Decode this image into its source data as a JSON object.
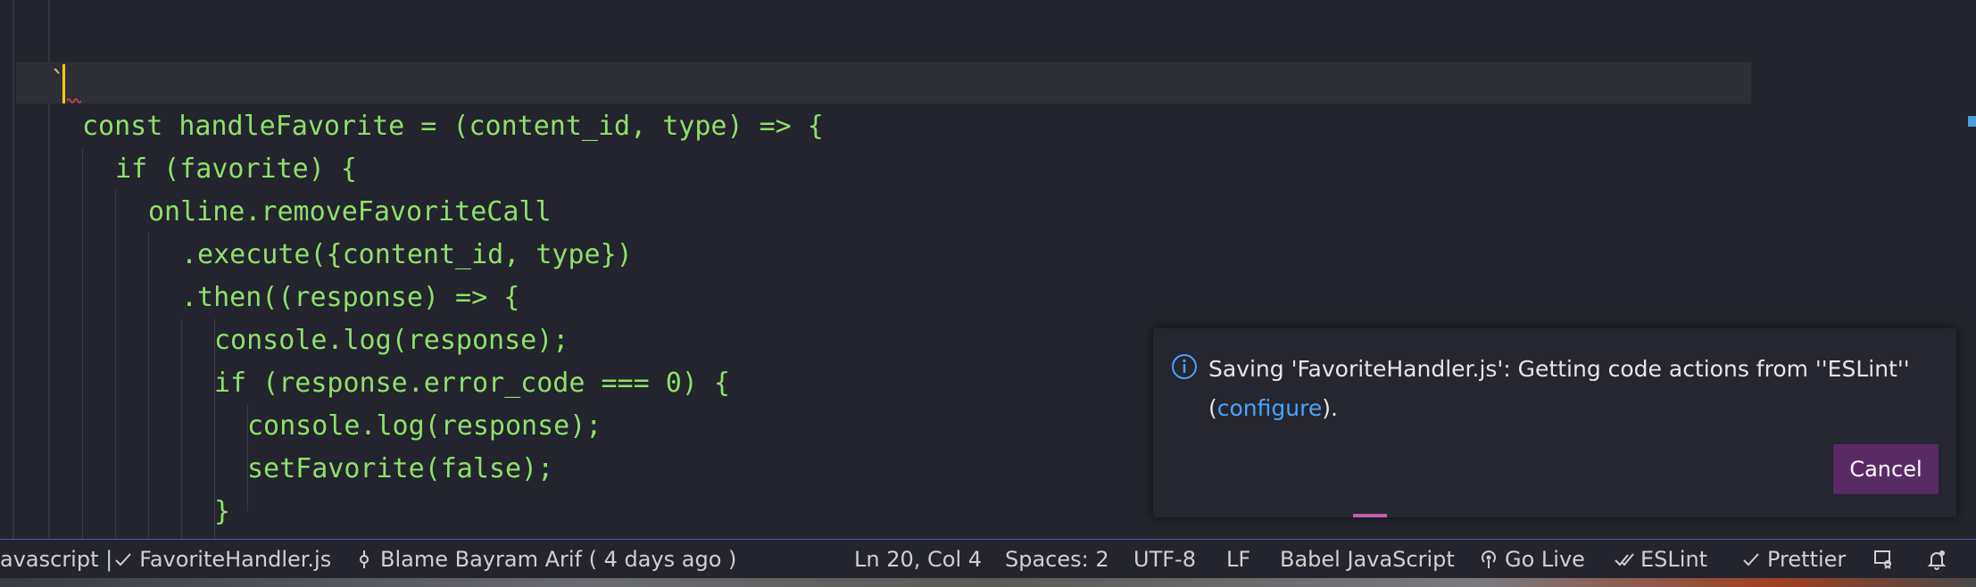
{
  "editor": {
    "backtick": "`",
    "lines": [
      "const handleFavorite = (content_id, type) => {",
      "if (favorite) {",
      "online.removeFavoriteCall",
      ".execute({content_id, type})",
      ".then((response) => {",
      "console.log(response);",
      "if (response.error_code === 0) {",
      "console.log(response);",
      "setFavorite(false);",
      "}"
    ]
  },
  "notification": {
    "message_prefix": "Saving 'FavoriteHandler.js': Getting code actions from ''ESLint''",
    "paren_open": "(",
    "link": "configure",
    "paren_close": ").",
    "cancel_label": "Cancel",
    "icon": "info-icon"
  },
  "statusbar": {
    "language_file": "avascript | ",
    "filename": "FavoriteHandler.js",
    "blame": "Blame Bayram Arif ( 4 days ago )",
    "position": "Ln 20, Col 4",
    "spaces": "Spaces: 2",
    "encoding": "UTF-8",
    "eol": "LF",
    "language_mode": "Babel JavaScript",
    "go_live": "Go Live",
    "eslint": "ESLint",
    "prettier": "Prettier"
  },
  "colors": {
    "code": "#8fe06a",
    "cursor": "#f0d000",
    "link": "#4aa3ff",
    "button": "#5a2a66",
    "statusbar_border": "#5055a8"
  }
}
